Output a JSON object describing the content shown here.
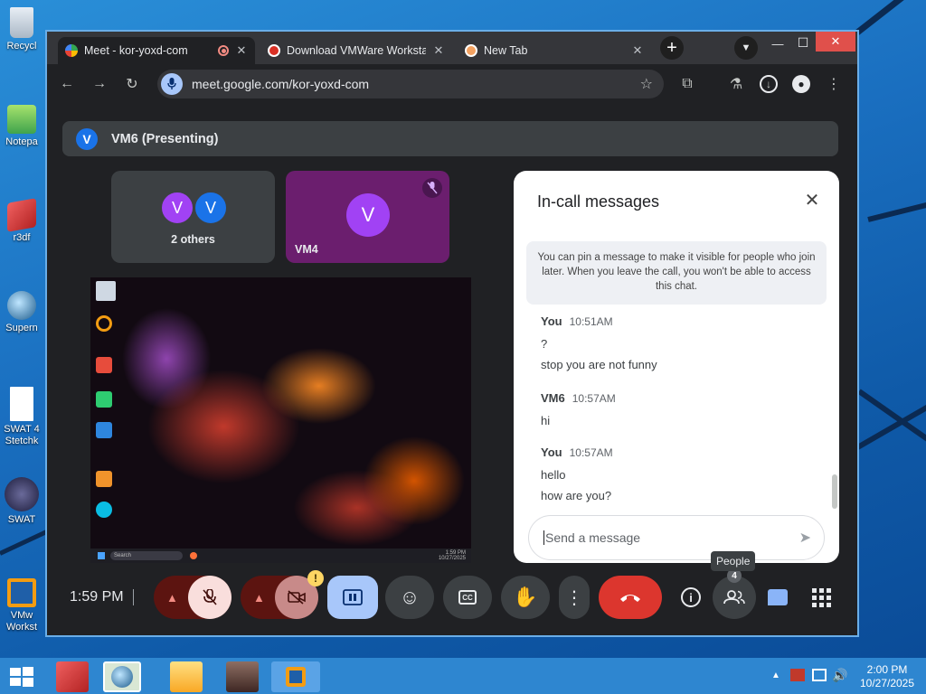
{
  "desktop": {
    "icons": [
      {
        "label": "Recycl",
        "name": "recycle-bin-icon"
      },
      {
        "label": "Notepa",
        "name": "notepad-icon"
      },
      {
        "label": "r3df",
        "name": "r3df-icon"
      },
      {
        "label": "Supern",
        "name": "supern-icon"
      },
      {
        "label": "SWAT 4\nStetchk",
        "name": "swat-doc-icon"
      },
      {
        "label": "SWAT",
        "name": "swat-icon"
      },
      {
        "label": "VMw\nWorkst",
        "name": "vmware-icon"
      }
    ]
  },
  "browser": {
    "tabs": [
      {
        "title": "Meet - kor-yoxd-com",
        "close": "✕"
      },
      {
        "title": "Download VMWare Workstati",
        "close": "✕"
      },
      {
        "title": "New Tab",
        "close": "✕"
      }
    ],
    "new_tab": "+",
    "url": "meet.google.com/kor-yoxd-com",
    "window_controls": {
      "minimize": "—",
      "maximize": "☐",
      "close": "✕"
    }
  },
  "meet": {
    "presenting": {
      "avatar": "V",
      "label": "VM6 (Presenting)"
    },
    "tiles": [
      {
        "label": "2 others",
        "avatars": [
          "V",
          "V"
        ]
      },
      {
        "label": "VM4",
        "avatar": "V"
      }
    ],
    "shared_screen": {
      "taskbar_search": "Search",
      "clock_time": "1:59 PM",
      "clock_date": "10/27/2025"
    },
    "chat": {
      "title": "In-call messages",
      "close": "✕",
      "notice": "You can pin a message to make it visible for people who join later. When you leave the call, you won't be able to access this chat.",
      "messages": [
        {
          "sender": "You",
          "time": "10:51AM",
          "lines": [
            "?",
            "stop you are not funny"
          ]
        },
        {
          "sender": "VM6",
          "time": "10:57AM",
          "lines": [
            "hi"
          ]
        },
        {
          "sender": "You",
          "time": "10:57AM",
          "lines": [
            "hello",
            "how are you?"
          ]
        }
      ],
      "input_placeholder": "Send a message"
    },
    "controls": {
      "time": "1:59 PM",
      "people_tooltip": "People",
      "people_count": "4",
      "warning_badge": "!"
    }
  },
  "taskbar": {
    "clock_time": "2:00 PM",
    "clock_date": "10/27/2025"
  }
}
